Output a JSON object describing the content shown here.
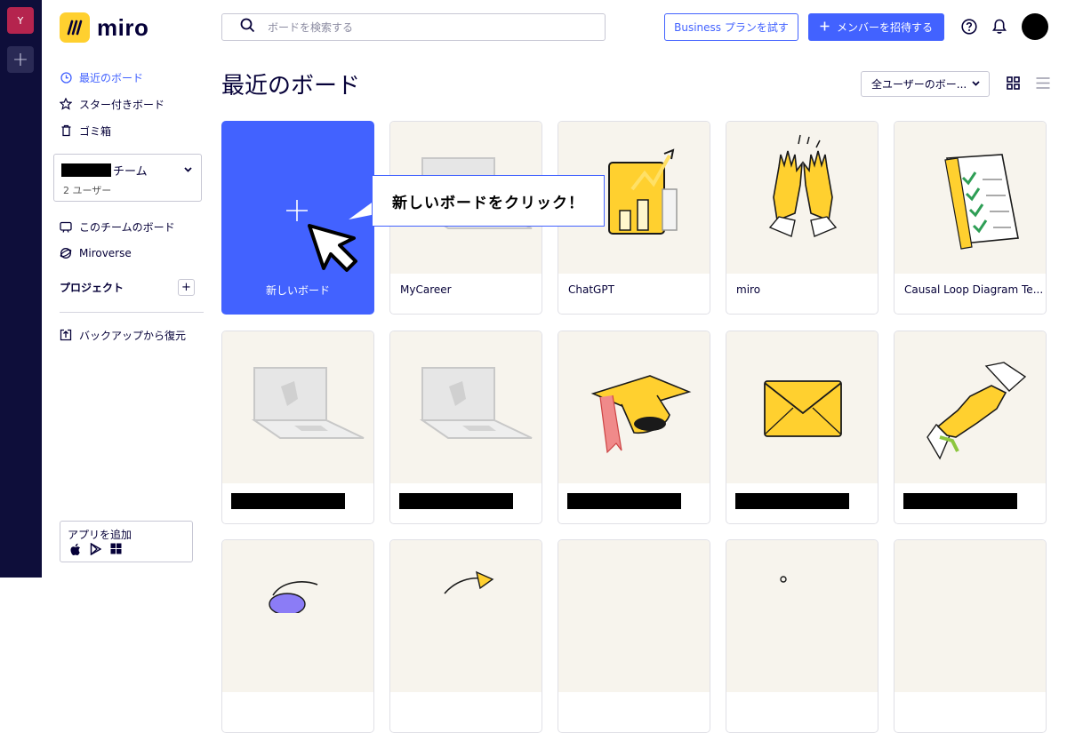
{
  "rail": {
    "workspace_initial": "Y",
    "add_symbol": "+"
  },
  "brand": {
    "name": "miro",
    "color": "#ffd02f"
  },
  "sidebar": {
    "nav": [
      {
        "label": "最近のボード",
        "icon": "clock-icon",
        "active": true
      },
      {
        "label": "スター付きボード",
        "icon": "star-icon"
      },
      {
        "label": "ゴミ箱",
        "icon": "trash-icon"
      }
    ],
    "team": {
      "name_suffix": "チーム",
      "member_count": "2 ユーザー"
    },
    "team_nav": [
      {
        "label": "このチームのボード",
        "icon": "board-icon"
      },
      {
        "label": "Miroverse",
        "icon": "miroverse-icon"
      }
    ],
    "projects_label": "プロジェクト",
    "restore_label": "バックアップから復元",
    "apps": {
      "title": "アプリを追加",
      "platforms": [
        "apple-icon",
        "google-play-icon",
        "windows-icon"
      ]
    }
  },
  "topbar": {
    "search_placeholder": "ボードを検索する",
    "business_label": "Business プランを試す",
    "invite_label": "メンバーを招待する",
    "accent": "#4262ff"
  },
  "main": {
    "title": "最近のボード",
    "filter_label": "全ユーザーのボー...",
    "new_board_label": "新しいボード",
    "callout": "新しいボードをクリック！",
    "boards": [
      {
        "name": "MyCareer",
        "thumb": "laptop"
      },
      {
        "name": "ChatGPT",
        "thumb": "chart"
      },
      {
        "name": "miro",
        "thumb": "hands"
      },
      {
        "name": "Causal Loop Diagram Te...",
        "thumb": "checklist"
      },
      {
        "name": "",
        "thumb": "laptop",
        "redacted": true
      },
      {
        "name": "",
        "thumb": "laptop",
        "redacted": true
      },
      {
        "name": "",
        "thumb": "gradcap",
        "redacted": true
      },
      {
        "name": "",
        "thumb": "envelope",
        "redacted": true
      },
      {
        "name": "",
        "thumb": "handshake",
        "redacted": true
      }
    ]
  }
}
